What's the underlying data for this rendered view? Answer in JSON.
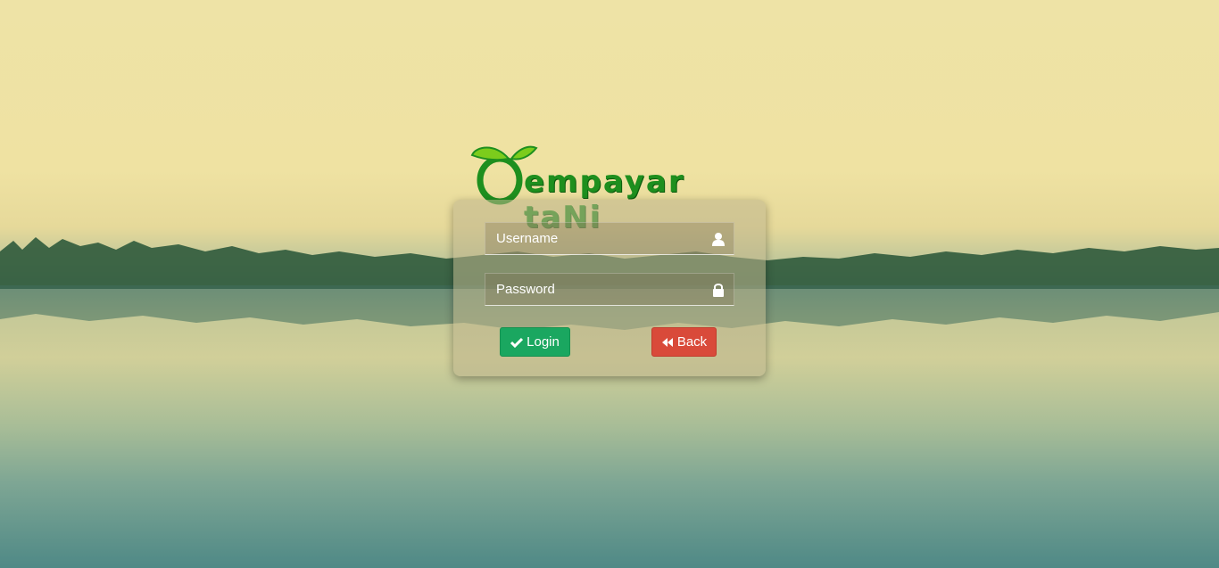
{
  "brand": {
    "logo_text": "empayar taNi",
    "logo_colors": {
      "primary": "#1e8f1e",
      "secondary": "#7ccc1c"
    }
  },
  "login_form": {
    "username": {
      "placeholder": "Username",
      "value": "",
      "icon": "user-icon"
    },
    "password": {
      "placeholder": "Password",
      "value": "",
      "icon": "lock-icon"
    },
    "login_button": {
      "label": "Login",
      "icon": "check-icon",
      "color": "#1aa760"
    },
    "back_button": {
      "label": "Back",
      "icon": "backward-icon",
      "color": "#d94a3a"
    }
  }
}
